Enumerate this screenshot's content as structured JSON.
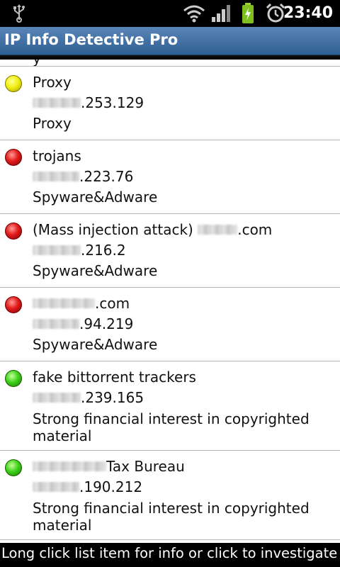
{
  "status_bar": {
    "time": "23:40",
    "icons": [
      "usb-icon",
      "wifi-icon",
      "signal-icon",
      "battery-charging-icon",
      "alarm-icon"
    ]
  },
  "app": {
    "title": "IP Info Detective Pro"
  },
  "list": {
    "items": [
      {
        "status": "yellow",
        "title": "Proxy",
        "ip_suffix": ".253.129",
        "category": "Proxy"
      },
      {
        "status": "red",
        "title": "trojans",
        "ip_suffix": ".223.76",
        "category": "Spyware&Adware"
      },
      {
        "status": "red",
        "title": "(Mass injection attack)",
        "title_suffix": ".com",
        "ip_suffix": ".216.2",
        "category": "Spyware&Adware"
      },
      {
        "status": "red",
        "title_suffix": ".com",
        "ip_suffix": ".94.219",
        "category": "Spyware&Adware"
      },
      {
        "status": "green",
        "title": "fake bittorrent trackers",
        "ip_suffix": ".239.165",
        "category": "Strong financial interest in copyrighted material"
      },
      {
        "status": "green",
        "title_suffix": "Tax Bureau",
        "ip_suffix": ".190.212",
        "category": "Strong financial interest in copyrighted material"
      }
    ]
  },
  "footer": {
    "hint": "Long click list item for info or click to investigate IP"
  },
  "colors": {
    "yellow": "#f2ef12",
    "red": "#e21b1b",
    "green": "#3fd31b",
    "titlebar": "#3f6fa5"
  }
}
